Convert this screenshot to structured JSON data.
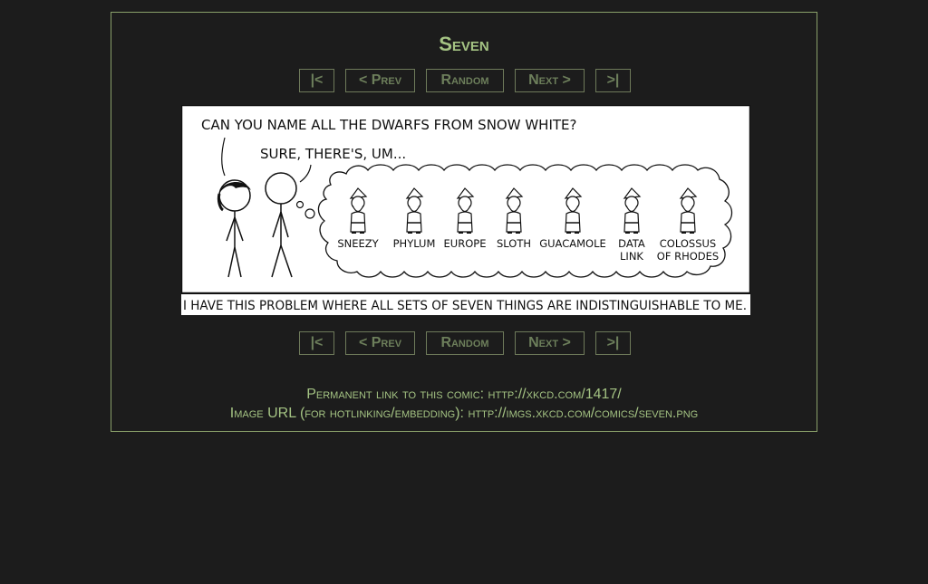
{
  "comic": {
    "title": "Seven",
    "caption": "I HAVE THIS PROBLEM WHERE ALL SETS OF SEVEN THINGS ARE INDISTINGUISHABLE TO ME.",
    "speech_1": "CAN YOU NAME ALL THE DWARFS FROM SNOW WHITE?",
    "speech_2": "SURE, THERE'S, UM...",
    "dwarfs": [
      {
        "line1": "SNEEZY",
        "line2": ""
      },
      {
        "line1": "PHYLUM",
        "line2": ""
      },
      {
        "line1": "EUROPE",
        "line2": ""
      },
      {
        "line1": "SLOTH",
        "line2": ""
      },
      {
        "line1": "GUACAMOLE",
        "line2": ""
      },
      {
        "line1": "DATA",
        "line2": "LINK"
      },
      {
        "line1": "COLOSSUS",
        "line2": "OF RHODES"
      }
    ]
  },
  "nav": {
    "first": "|<",
    "prev": "< Prev",
    "random": "Random",
    "next": "Next >",
    "last": ">|"
  },
  "footer": {
    "permalink_label": "Permanent link to this comic: ",
    "permalink_url": "http://xkcd.com/1417/",
    "imageurl_label": "Image URL (for hotlinking/embedding): ",
    "imageurl_url": "http://imgs.xkcd.com/comics/seven.png"
  },
  "colors": {
    "background": "#1c1c1c",
    "accent": "#a4c383",
    "button_text": "#6d7f5b",
    "border": "#8aa06a"
  }
}
